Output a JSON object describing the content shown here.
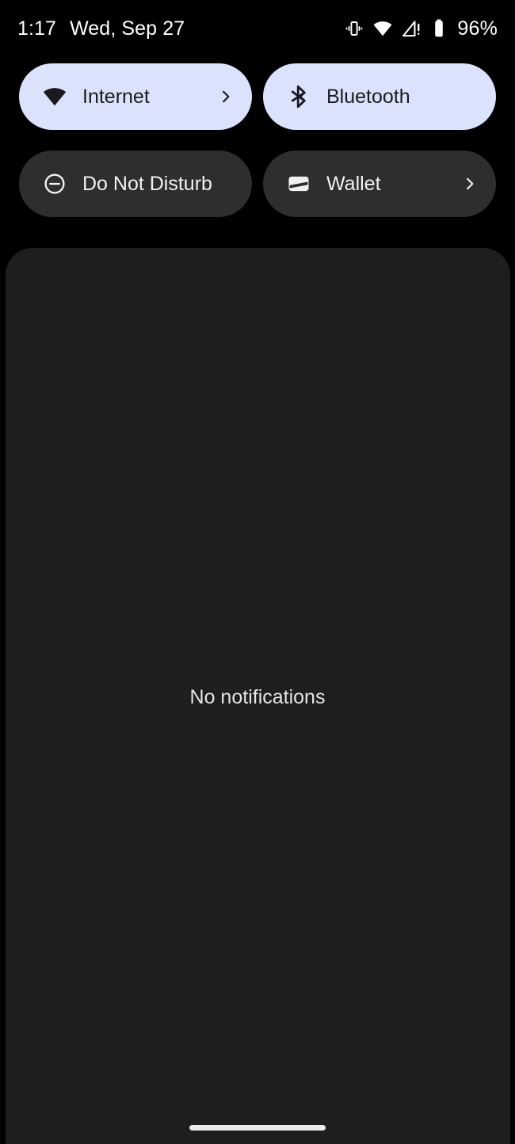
{
  "status_bar": {
    "clock": "1:17",
    "date": "Wed, Sep 27",
    "battery_percent": "96%",
    "icons": [
      {
        "name": "vibrate-icon",
        "label": "Ringer set to vibrate"
      },
      {
        "name": "wifi-icon",
        "label": "Wi-Fi connected, full signal"
      },
      {
        "name": "cellular-no-service-icon",
        "label": "No mobile service"
      },
      {
        "name": "battery-icon",
        "label": "Battery full"
      }
    ]
  },
  "quick_settings": {
    "tiles": [
      {
        "label": "Internet",
        "icon": "wifi-icon",
        "state": "active",
        "has_chevron": true
      },
      {
        "label": "Bluetooth",
        "icon": "bluetooth-icon",
        "state": "active",
        "has_chevron": false
      },
      {
        "label": "Do Not Disturb",
        "icon": "do-not-disturb-icon",
        "state": "inactive",
        "has_chevron": false
      },
      {
        "label": "Wallet",
        "icon": "wallet-icon",
        "state": "inactive",
        "has_chevron": true
      }
    ]
  },
  "notification_shade": {
    "empty_text": "No notifications"
  },
  "navigation": {
    "home_indicator_label": "Home gesture bar"
  },
  "colors": {
    "background": "#000000",
    "tile_active_bg": "#dbe2fb",
    "tile_active_fg": "#1b1b1f",
    "tile_inactive_bg": "#2e2e30",
    "tile_inactive_fg": "#f1f1f3",
    "shade_bg": "#1e1e20",
    "status_text": "#ffffff"
  }
}
